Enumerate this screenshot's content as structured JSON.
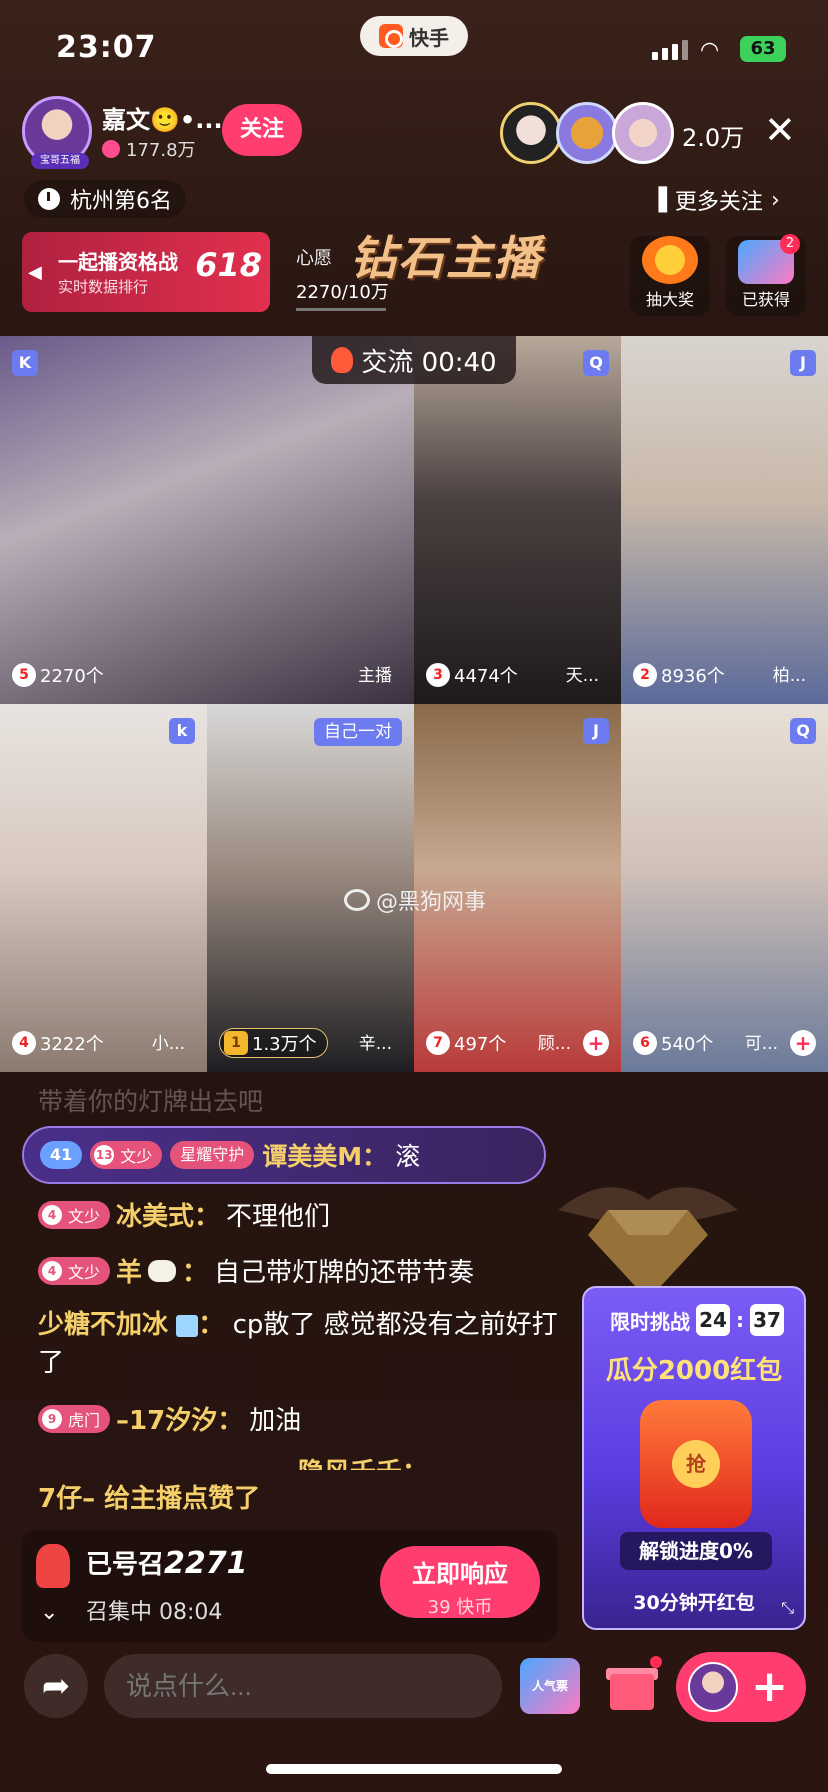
{
  "status_bar": {
    "time": "23:07",
    "battery": "63"
  },
  "app": {
    "name": "快手"
  },
  "host": {
    "name": "嘉文🙂•...",
    "likes": "177.8万",
    "follow_label": "关注",
    "avatar_tag": "宝哥五福"
  },
  "viewers": {
    "count": "2.0万"
  },
  "rank": {
    "label": "杭州第6名"
  },
  "more_follow": {
    "label": "更多关注"
  },
  "banner": {
    "title": "一起播资格战",
    "subtitle": "实时数据排行",
    "badge": "618"
  },
  "wish": {
    "label": "心愿",
    "progress": "2270/10万"
  },
  "diamond_host": {
    "title": "钻石主播"
  },
  "lottery": {
    "label": "抽大奖"
  },
  "obtained": {
    "label": "已获得",
    "badge": "2"
  },
  "pk": {
    "label": "交流 00:40"
  },
  "tiles": [
    {
      "letter": "K",
      "rank": "5",
      "count": "2270个",
      "who": "主播"
    },
    {
      "letter": "Q",
      "rank": "3",
      "count": "4474个",
      "who": "天..."
    },
    {
      "letter": "J",
      "rank": "2",
      "count": "8936个",
      "who": "柏..."
    },
    {
      "letter": "k",
      "rank": "4",
      "count": "3222个",
      "who": "小..."
    },
    {
      "tag": "自己一对",
      "rank": "1",
      "count": "1.3万个",
      "who": "辛..."
    },
    {
      "letter": "J",
      "rank": "7",
      "count": "497个",
      "who": "顾..."
    },
    {
      "letter": "Q",
      "rank": "6",
      "count": "540个",
      "who": "可..."
    }
  ],
  "watermark": "@黑狗网事",
  "chat": {
    "fade_line": "带着你的灯牌出去吧",
    "special": {
      "level": "41",
      "fan_level": "13",
      "fan_name": "文少",
      "guard": "星耀守护",
      "user": "谭美美M：",
      "text": "滚"
    },
    "line1": {
      "fan_level": "4",
      "fan_name": "文少",
      "user": "冰美式：",
      "text": "不理他们"
    },
    "line2": {
      "fan_level": "4",
      "fan_name": "文少",
      "user": "羊",
      "text": "自己带灯牌的还带节奏"
    },
    "line3": {
      "user": "少糖不加冰",
      "text": "cp散了 感觉都没有之前好打了"
    },
    "line4": {
      "fan_level": "9",
      "fan_name": "虎门",
      "user": "–17汐汐：",
      "text": "加油"
    },
    "line5_partial": "隐风千千：",
    "like_notice": "7仔– 给主播点赞了"
  },
  "summon": {
    "title_prefix": "已号召",
    "count": "2271",
    "status": "召集中 08:04",
    "button_label": "立即响应",
    "button_sub": "39 快币"
  },
  "red_packet": {
    "title": "限时挑战",
    "minutes": "24",
    "seconds": "37",
    "headline": "瓜分2000红包",
    "seal": "抢",
    "unlock": "解锁进度0%",
    "footer": "30分钟开红包"
  },
  "bottom": {
    "comment_placeholder": "说点什么...",
    "promo_label": "人气票"
  },
  "colors": {
    "accent": "#ff3d6e",
    "username": "#f5cf6a",
    "tile_letter": "#6c7cf0"
  }
}
